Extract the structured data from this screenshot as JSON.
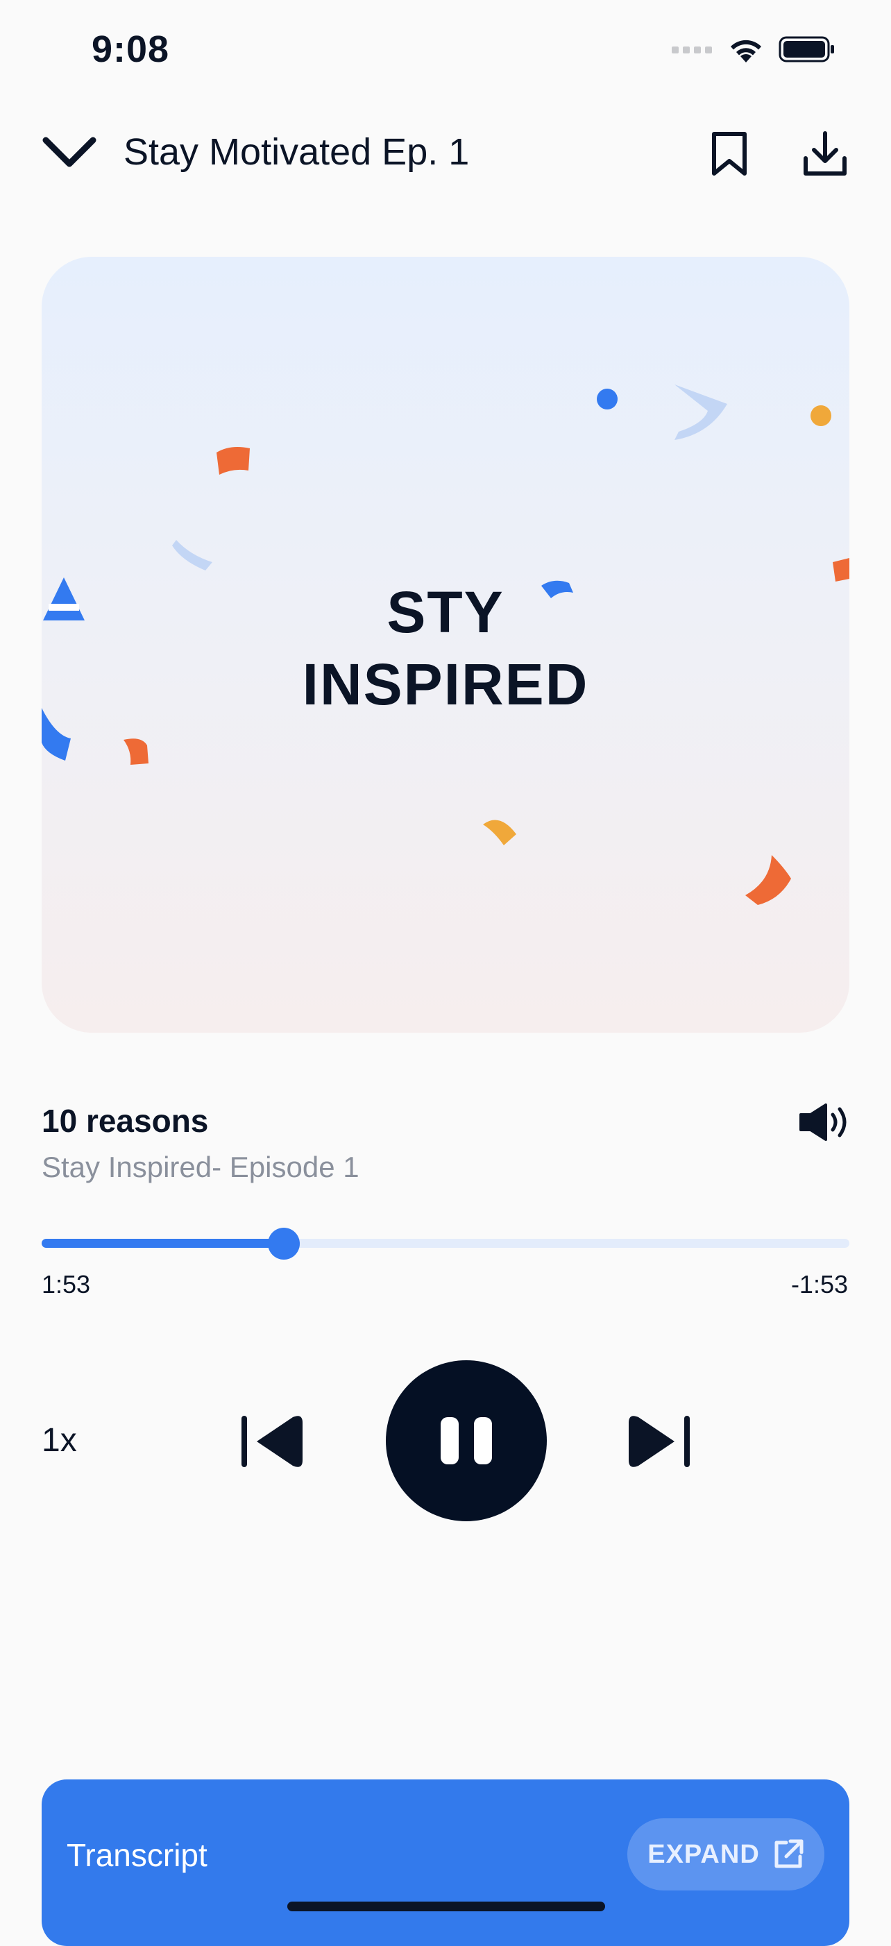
{
  "status_bar": {
    "time": "9:08"
  },
  "header": {
    "title": "Stay Motivated Ep. 1"
  },
  "artwork": {
    "line1_left": "ST",
    "line1_right": "Y",
    "line2": "INSPIRED"
  },
  "track": {
    "title": "10 reasons",
    "subtitle": "Stay Inspired- Episode 1"
  },
  "progress": {
    "fraction": 0.3,
    "elapsed": "1:53",
    "remaining": "-1:53"
  },
  "controls": {
    "speed": "1x"
  },
  "transcript": {
    "label": "Transcript",
    "expand_label": "EXPAND"
  },
  "colors": {
    "accent": "#337af0",
    "dark": "#051024",
    "orange": "#ee6a36",
    "yellow": "#f0a83a",
    "light_blue": "#c3d6f5"
  }
}
